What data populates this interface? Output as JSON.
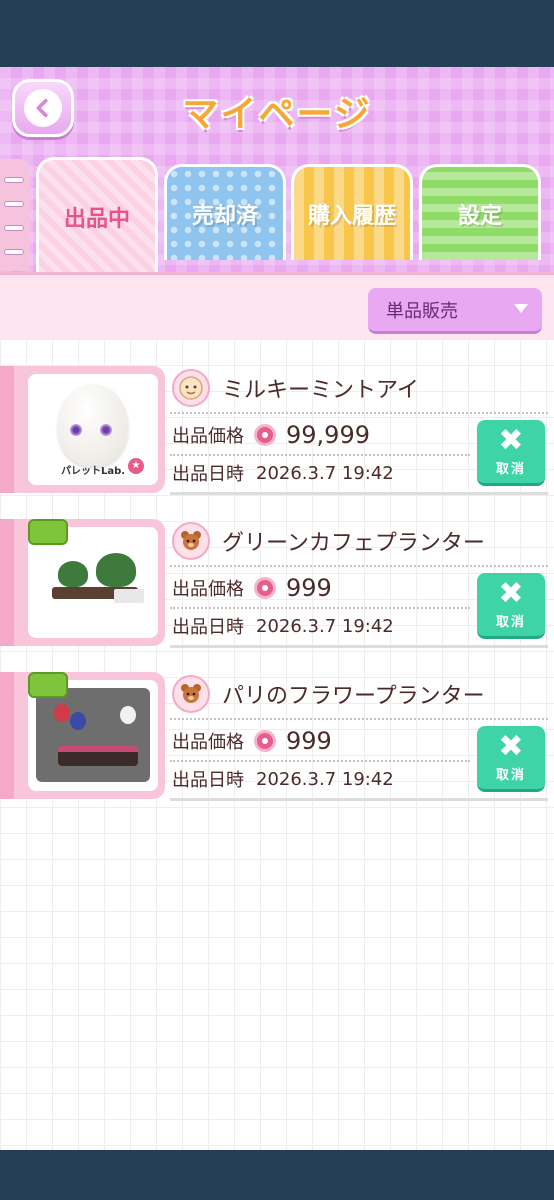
{
  "header": {
    "title": "マイページ"
  },
  "tabs": [
    {
      "label": "出品中",
      "active": true
    },
    {
      "label": "売却済",
      "active": false
    },
    {
      "label": "購入履歴",
      "active": false
    },
    {
      "label": "設定",
      "active": false
    }
  ],
  "filter": {
    "selected": "単品販売"
  },
  "labels": {
    "price": "出品価格",
    "date": "出品日時",
    "cancel": "取消",
    "cancel_symbol": "✖"
  },
  "listings": [
    {
      "name": "ミルキーミントアイ",
      "price": "99,999",
      "date": "2026.3.7 19:42",
      "brand": "パレットLab.",
      "badge_icon": "face-icon"
    },
    {
      "name": "グリーンカフェプランター",
      "price": "999",
      "date": "2026.3.7 19:42",
      "badge_icon": "bear-icon"
    },
    {
      "name": "パリのフラワープランター",
      "price": "999",
      "date": "2026.3.7 19:42",
      "badge_icon": "bear-icon"
    }
  ],
  "colors": {
    "header_bg": "#e9a8f0",
    "title": "#f7a638",
    "cancel": "#3fd4a8",
    "donut": "#e75d8e"
  }
}
